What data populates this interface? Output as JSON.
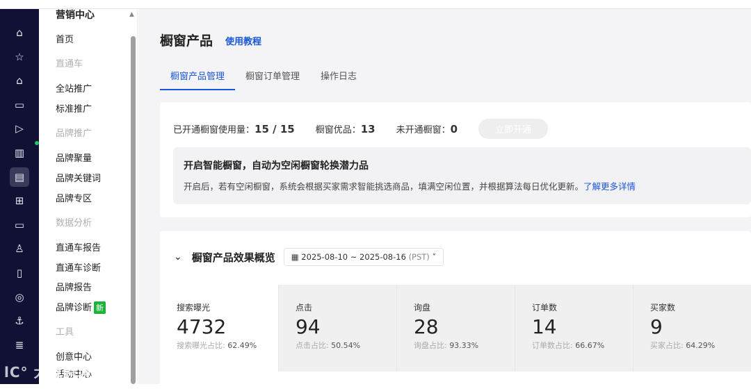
{
  "rail": {
    "icons": [
      "home-icon",
      "star-icon",
      "store-icon",
      "browser-icon",
      "video-icon",
      "chart-icon",
      "ad-icon",
      "ticket-icon",
      "message-icon",
      "users-icon",
      "clipboard-icon",
      "globe-icon",
      "ship-icon",
      "database-icon"
    ],
    "glyphs": [
      "⌂",
      "☆",
      "⌂",
      "▭",
      "▷",
      "▥",
      "▤",
      "⊞",
      "▭",
      "♙",
      "▯",
      "◎",
      "⚓",
      "≣"
    ]
  },
  "nav": {
    "heading": "营销中心",
    "items": [
      {
        "label": "首页",
        "type": "item"
      },
      {
        "label": "直通车",
        "type": "group"
      },
      {
        "label": "全站推广",
        "type": "item"
      },
      {
        "label": "标准推广",
        "type": "item"
      },
      {
        "label": "品牌推广",
        "type": "group"
      },
      {
        "label": "品牌聚量",
        "type": "item"
      },
      {
        "label": "品牌关键词",
        "type": "item"
      },
      {
        "label": "品牌专区",
        "type": "item"
      },
      {
        "label": "数据分析",
        "type": "group"
      },
      {
        "label": "直通车报告",
        "type": "item"
      },
      {
        "label": "直通车诊断",
        "type": "item"
      },
      {
        "label": "品牌报告",
        "type": "item"
      },
      {
        "label": "品牌诊断",
        "type": "item",
        "badge": "新"
      },
      {
        "label": "工具",
        "type": "group"
      },
      {
        "label": "创意中心",
        "type": "item"
      },
      {
        "label": "活动中心",
        "type": "item"
      }
    ]
  },
  "header": {
    "title": "橱窗产品",
    "tutorial": "使用教程"
  },
  "tabs": [
    "橱窗产品管理",
    "橱窗订单管理",
    "操作日志"
  ],
  "stats": {
    "used_label": "已开通橱窗使用量：",
    "used_value": "15 / 15",
    "quality_label": "橱窗优品：",
    "quality_value": "13",
    "unopened_label": "未开通橱窗：",
    "unopened_value": "0",
    "open_button": "立即开通"
  },
  "smart": {
    "title": "开启智能橱窗，自动为空闲橱窗轮换潜力品",
    "desc": "开启后，若有空闲橱窗，系统会根据买家需求智能挑选商品，填满空闲位置，并根据算法每日优化更新。",
    "link": "了解更多详情"
  },
  "overview": {
    "title": "橱窗产品效果概览",
    "date_range": "2025-08-10 ~ 2025-08-16",
    "tz": "(PST)"
  },
  "metrics": [
    {
      "label": "搜索曝光",
      "value": "4732",
      "ratio_label": "搜索曝光占比:",
      "ratio": "62.49%"
    },
    {
      "label": "点击",
      "value": "94",
      "ratio_label": "点击占比:",
      "ratio": "50.54%"
    },
    {
      "label": "询盘",
      "value": "28",
      "ratio_label": "询盘占比:",
      "ratio": "93.33%"
    },
    {
      "label": "订单数",
      "value": "14",
      "ratio_label": "订单数占比:",
      "ratio": "66.67%"
    },
    {
      "label": "买家数",
      "value": "9",
      "ratio_label": "买家占比:",
      "ratio": "64.29%"
    }
  ],
  "watermark": "大数跨境",
  "colors": {
    "accent": "#1a56db",
    "rail": "#111136",
    "badge": "#1db33a"
  }
}
